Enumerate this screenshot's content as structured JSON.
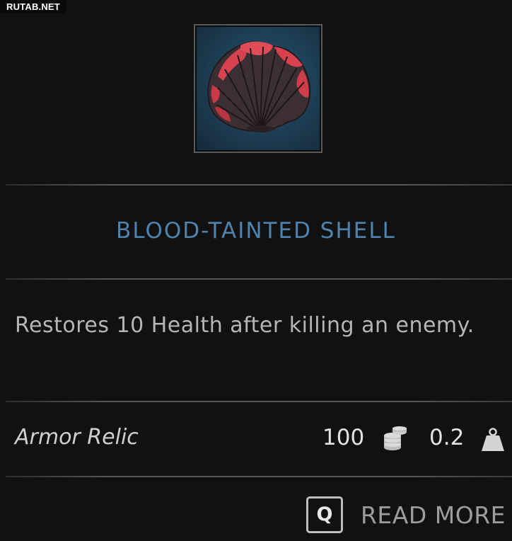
{
  "watermark": "RUTAB.NET",
  "item": {
    "icon": "scallop-shell-icon",
    "name": "BLOOD-TAINTED SHELL",
    "description": "Restores 10 Health after killing an enemy.",
    "type": "Armor Relic",
    "gold": "100",
    "gold_icon": "coin-stack-icon",
    "weight": "0.2",
    "weight_icon": "weight-icon"
  },
  "footer": {
    "key": "Q",
    "read_more_label": "READ MORE"
  },
  "colors": {
    "background": "#111111",
    "title": "#4f83ad",
    "icon_background": "#1f4259",
    "shell_red": "#d8424e"
  }
}
